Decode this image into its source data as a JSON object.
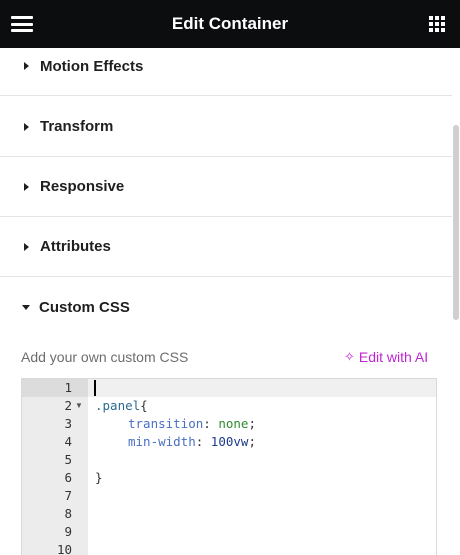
{
  "header": {
    "title": "Edit Container",
    "menu_icon": "hamburger-icon",
    "apps_icon": "grid-icon"
  },
  "sections": [
    {
      "label": "Motion Effects",
      "expanded": false
    },
    {
      "label": "Transform",
      "expanded": false
    },
    {
      "label": "Responsive",
      "expanded": false
    },
    {
      "label": "Attributes",
      "expanded": false
    },
    {
      "label": "Custom CSS",
      "expanded": true
    }
  ],
  "custom_css": {
    "help_text": "Add your own custom CSS",
    "ai_link": "Edit with AI",
    "ai_icon": "sparkle-icon",
    "accent_color": "#c026d3"
  },
  "editor": {
    "line_numbers": [
      "1",
      "2",
      "3",
      "4",
      "5",
      "6",
      "7",
      "8",
      "9",
      "10"
    ],
    "lines": {
      "l2_selector": ".panel",
      "l2_brace": "{",
      "l3_prop": "transition",
      "l3_colon": ": ",
      "l3_value": "none",
      "l3_semi": ";",
      "l4_prop": "min-width",
      "l4_colon": ": ",
      "l4_value": "100vw",
      "l4_semi": ";",
      "l6_brace": "}"
    }
  }
}
